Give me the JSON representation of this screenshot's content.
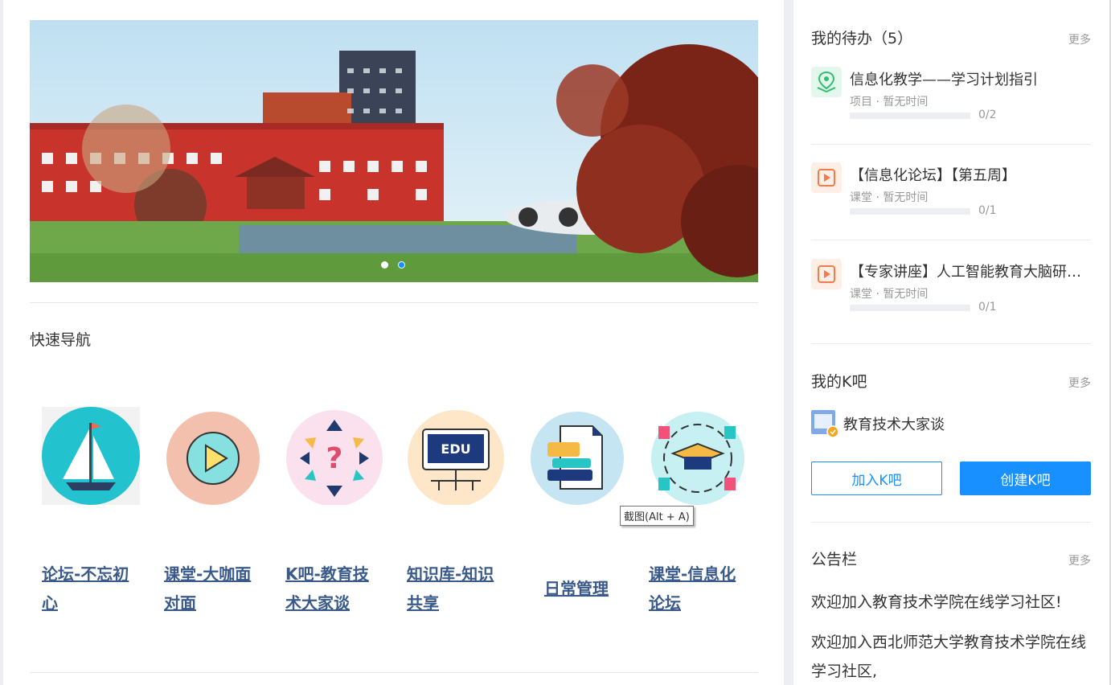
{
  "banner": {
    "active_index": 1,
    "slide_count": 2
  },
  "quick_nav": {
    "title": "快速导航",
    "items": [
      {
        "label": "论坛-不忘初心",
        "icon": "sailboat-icon"
      },
      {
        "label": "课堂-大咖面对面",
        "icon": "play-icon"
      },
      {
        "label": "K吧-教育技术大家谈",
        "icon": "question-arrows-icon"
      },
      {
        "label": "知识库-知识共享",
        "icon": "edu-monitor-icon"
      },
      {
        "label": "日常管理",
        "icon": "document-icon"
      },
      {
        "label": "课堂-信息化论坛",
        "icon": "graduation-cap-icon"
      }
    ]
  },
  "tooltip": "截图(Alt + A)",
  "todo": {
    "title": "我的待办（5）",
    "more": "更多",
    "items": [
      {
        "title": "信息化教学——学习计划指引",
        "meta": "项目 · 暂无时间",
        "progress": "0/2",
        "icon": "map-pin-icon"
      },
      {
        "title": "【信息化论坛】【第五周】",
        "meta": "课堂 · 暂无时间",
        "progress": "0/1",
        "icon": "play-icon"
      },
      {
        "title": "【专家讲座】人工智能教育大脑研…",
        "meta": "课堂 · 暂无时间",
        "progress": "0/1",
        "icon": "play-icon"
      }
    ]
  },
  "kba": {
    "title": "我的K吧",
    "more": "更多",
    "name": "教育技术大家谈",
    "join_label": "加入K吧",
    "create_label": "创建K吧"
  },
  "notice": {
    "title": "公告栏",
    "more": "更多",
    "items": [
      "欢迎加入教育技术学院在线学习社区!",
      "欢迎加入西北师范大学教育技术学院在线学习社区,"
    ]
  },
  "colors": {
    "accent": "#1890ff",
    "link": "#3a5a8c"
  }
}
